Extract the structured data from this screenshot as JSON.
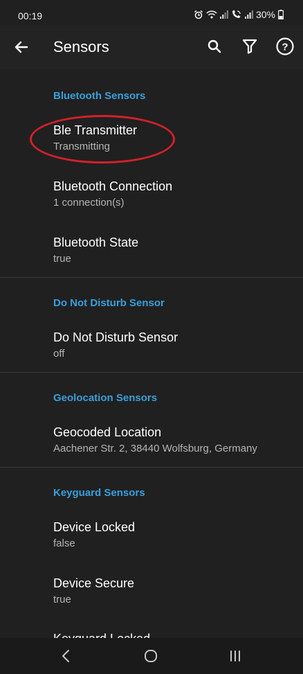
{
  "status": {
    "time": "00:19",
    "battery": "30%"
  },
  "appbar": {
    "title": "Sensors",
    "icons": [
      "back-arrow-icon",
      "search-icon",
      "filter-icon",
      "help-icon"
    ]
  },
  "sections": [
    {
      "header": "Bluetooth Sensors",
      "items": [
        {
          "title": "Ble Transmitter",
          "subtitle": "Transmitting"
        },
        {
          "title": "Bluetooth Connection",
          "subtitle": "1 connection(s)"
        },
        {
          "title": "Bluetooth State",
          "subtitle": "true"
        }
      ]
    },
    {
      "header": "Do Not Disturb Sensor",
      "items": [
        {
          "title": "Do Not Disturb Sensor",
          "subtitle": "off"
        }
      ]
    },
    {
      "header": "Geolocation Sensors",
      "items": [
        {
          "title": "Geocoded Location",
          "subtitle": "Aachener Str. 2, 38440 Wolfsburg, Germany"
        }
      ]
    },
    {
      "header": "Keyguard Sensors",
      "items": [
        {
          "title": "Device Locked",
          "subtitle": "false"
        },
        {
          "title": "Device Secure",
          "subtitle": "true"
        },
        {
          "title": "Keyguard Locked"
        }
      ]
    }
  ],
  "colors": {
    "background": "#202020",
    "accent": "#3a9fdb",
    "highlight": "#d3202a"
  }
}
